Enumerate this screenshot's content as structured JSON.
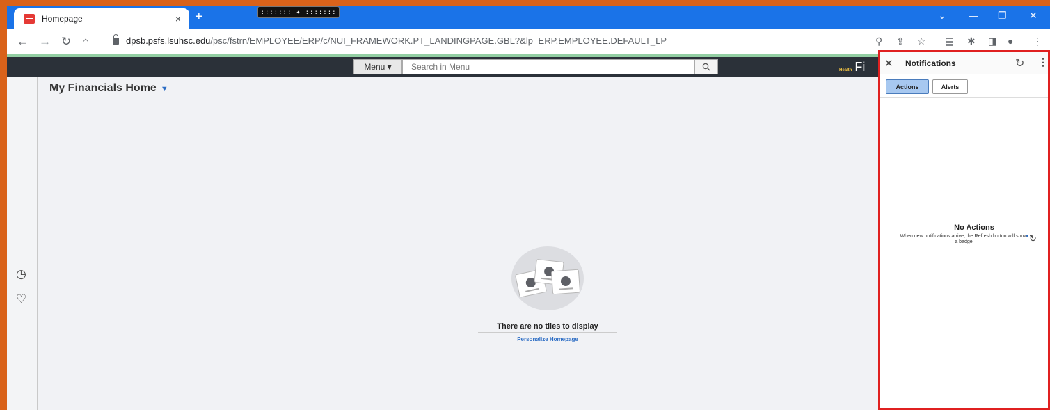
{
  "browser": {
    "tab_title": "Homepage",
    "tab_close": "×",
    "new_tab": "+",
    "drag_pill": "::::::: ✦ :::::::",
    "url_domain": "dpsb.psfs.lsuhsc.edu",
    "url_path": "/psc/fstrn/EMPLOYEE/ERP/c/NUI_FRAMEWORK.PT_LANDINGPAGE.GBL?&lp=ERP.EMPLOYEE.DEFAULT_LP"
  },
  "header": {
    "menu_label": "Menu ▾",
    "search_placeholder": "Search in Menu",
    "brand_small": "Health",
    "brand_text": "Fi"
  },
  "main": {
    "page_title": "My Financials Home",
    "empty_text": "There are no tiles to display",
    "personalize_link": "Personalize Homepage"
  },
  "notifications": {
    "title": "Notifications",
    "tabs": [
      "Actions",
      "Alerts"
    ],
    "empty_heading": "No Actions",
    "empty_message": "When new notifications arrive, the Refresh button will show a badge"
  },
  "colors": {
    "border_accent": "#d9621a",
    "tab_strip": "#1a73e8",
    "panel_highlight": "#e02020",
    "link": "#2b6cc4"
  }
}
